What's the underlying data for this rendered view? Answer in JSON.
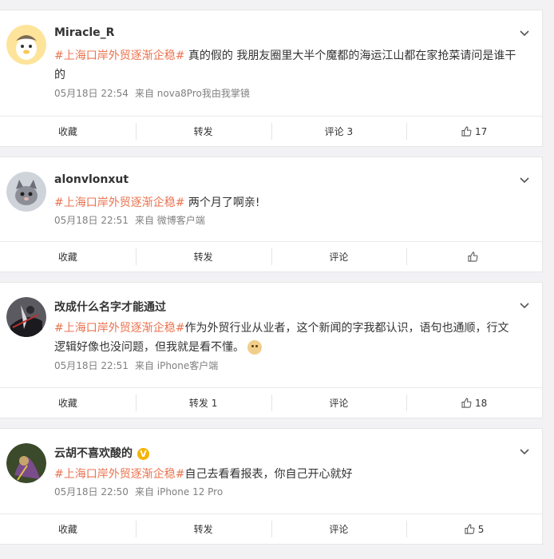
{
  "comments": [
    {
      "username": "Miracle_R",
      "hashtag": "#上海口岸外贸逐渐企稳#",
      "body": " 真的假的 我朋友圈里大半个魔都的海运江山都在家抢菜请问是谁干的",
      "time": "05月18日 22:54",
      "source": "来自 nova8Pro我由我掌镜",
      "actions": {
        "collect": "收藏",
        "repost": "转发",
        "comment": "评论 3",
        "like": "17"
      },
      "avatar_colors": [
        "#fde49a",
        "#f6c94e"
      ]
    },
    {
      "username": "alonvlonxut",
      "hashtag": "#上海口岸外贸逐渐企稳#",
      "body": " 两个月了啊亲!",
      "time": "05月18日 22:51",
      "source": "来自 微博客户端",
      "actions": {
        "collect": "收藏",
        "repost": "转发",
        "comment": "评论",
        "like": ""
      },
      "avatar_colors": [
        "#cfd3da",
        "#6d6f78"
      ]
    },
    {
      "username": "改成什么名字才能通过",
      "hashtag": "#上海口岸外贸逐渐企稳#",
      "body": "作为外贸行业从业者，这个新闻的字我都认识，语句也通顺，行文逻辑好像也没问题，但我就是看不懂。",
      "time": "05月18日 22:51",
      "source": "来自 iPhone客户端",
      "actions": {
        "collect": "收藏",
        "repost": "转发 1",
        "comment": "评论",
        "like": "18"
      },
      "avatar_colors": [
        "#5a5a60",
        "#1a1a1f"
      ]
    },
    {
      "username": "云胡不喜欢酸的",
      "hashtag": "#上海口岸外贸逐渐企稳#",
      "body": "自己去看看报表，你自己开心就好",
      "time": "05月18日 22:50",
      "source": "来自 iPhone 12 Pro",
      "actions": {
        "collect": "收藏",
        "repost": "转发",
        "comment": "评论",
        "like": "5"
      },
      "avatar_colors": [
        "#3b4a2a",
        "#7a4c8c"
      ]
    }
  ],
  "icons": {
    "menu": "chevron-down-icon",
    "like": "thumbs-up-icon",
    "verified": "verified-badge-icon",
    "emoji": "doge-emoji-icon"
  },
  "verified_mark": "V"
}
